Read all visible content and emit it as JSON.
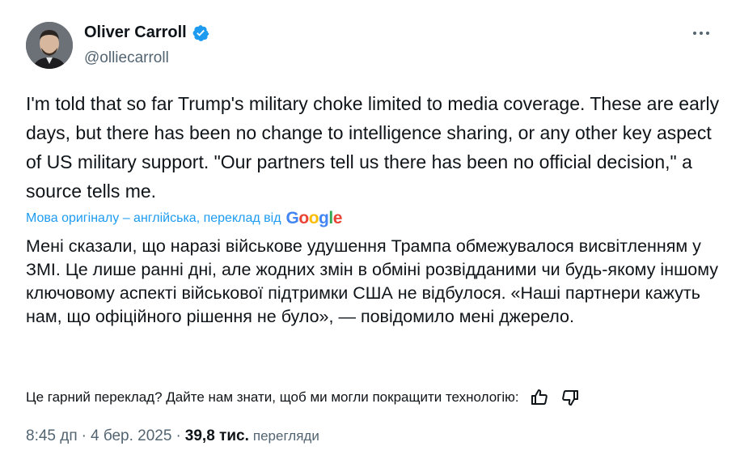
{
  "author": {
    "display_name": "Oliver Carroll",
    "handle": "@olliecarroll",
    "verified": true
  },
  "icons": {
    "verified": "verified-badge-icon",
    "more": "more-options-icon",
    "thumb_up": "thumbs-up-icon",
    "thumb_down": "thumbs-down-icon"
  },
  "tweet": {
    "text": "I'm told that so far Trump's military choke limited to media coverage. These are early days, but there has been no change to intelligence sharing, or any other key aspect of US military support. \"Our partners tell us there has been no official decision,\" a source tells me."
  },
  "translation": {
    "note": "Мова оригіналу – англійська, переклад від",
    "provider": "Google",
    "text": "Мені сказали, що наразі військове удушення Трампа обмежувалося висвітленням у ЗМІ. Це лише ранні дні, але жодних змін в обміні розвідданими чи будь-якому іншому ключовому аспекті військової підтримки США не відбулося. «Наші партнери кажуть нам, що офіційного рішення не було», — повідомило мені джерело.",
    "feedback_prompt": "Це гарний переклад? Дайте нам знати, щоб ми могли покращити технологію:"
  },
  "meta": {
    "time": "8:45 дп",
    "separator": "·",
    "date": "4 бер. 2025",
    "views_count": "39,8 тис.",
    "views_label": "перегляди"
  },
  "colors": {
    "accent": "#1d9bf0",
    "text_primary": "#0f1419",
    "text_secondary": "#536471",
    "background": "#ffffff"
  }
}
